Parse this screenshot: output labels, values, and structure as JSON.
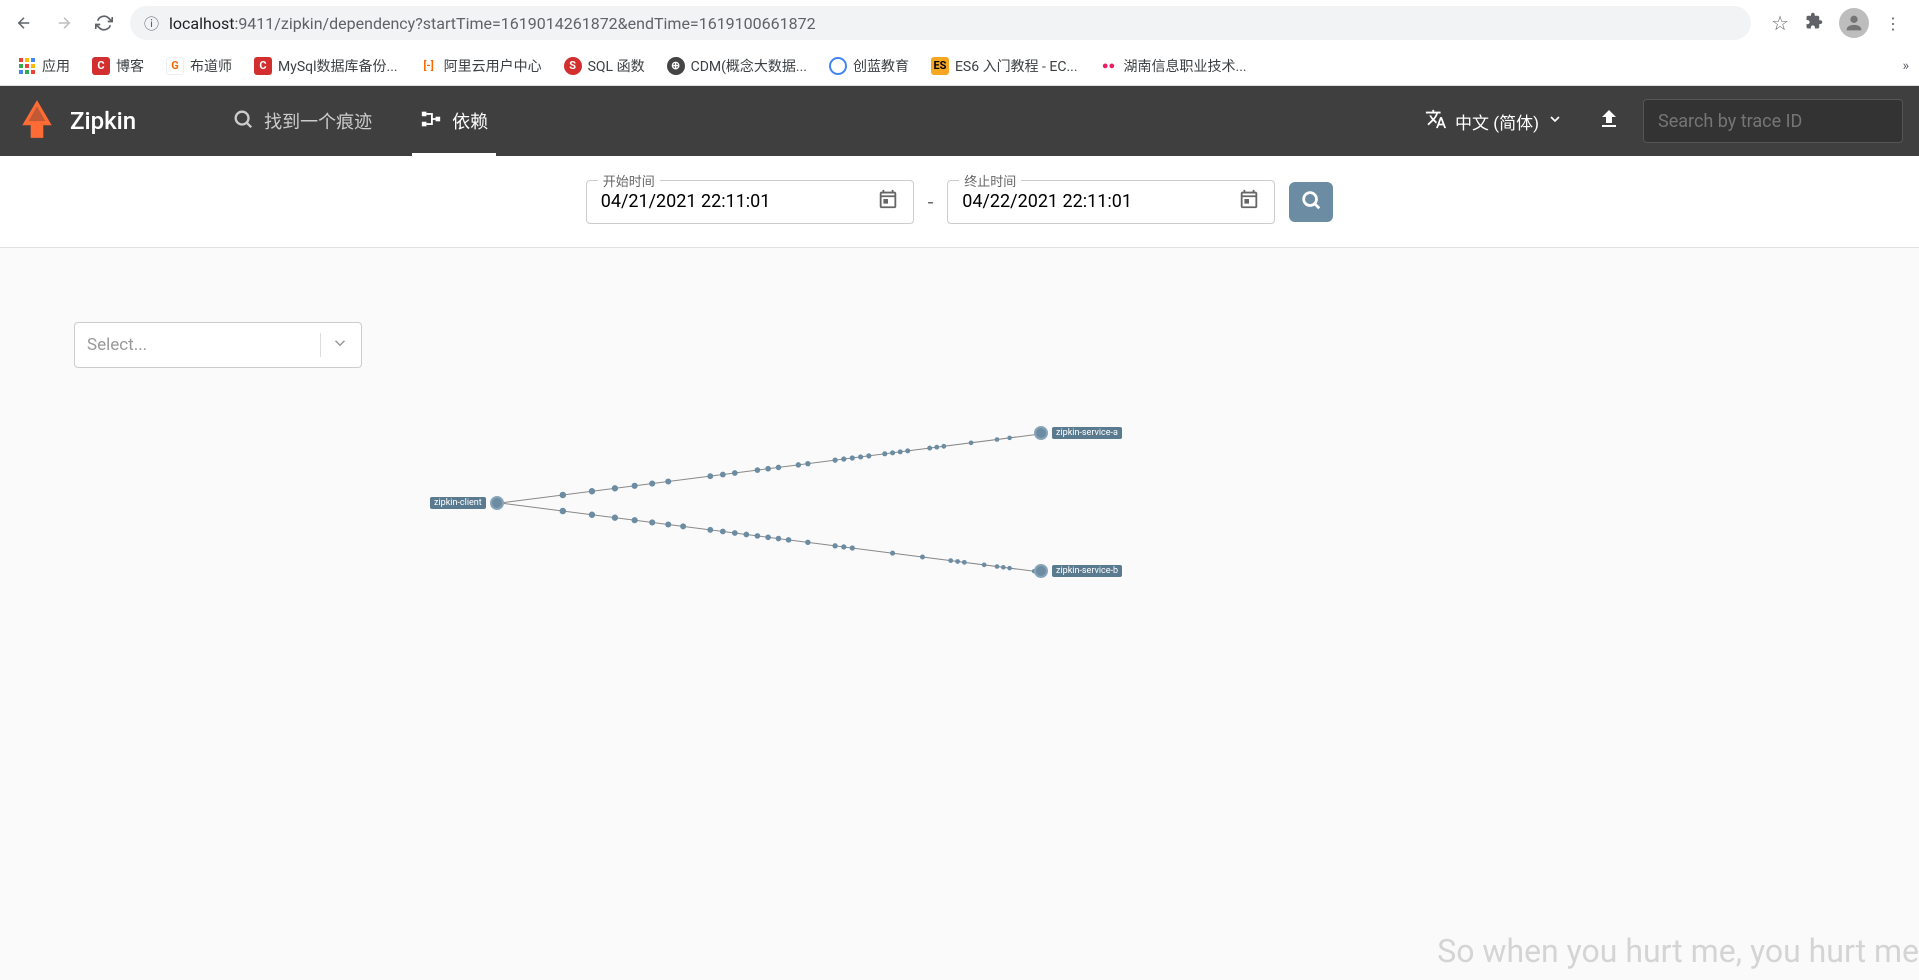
{
  "browser": {
    "url_domain": "localhost",
    "url_path": ":9411/zipkin/dependency?startTime=1619014261872&endTime=1619100661872"
  },
  "bookmarks": {
    "apps": "应用",
    "items": [
      {
        "label": "博客"
      },
      {
        "label": "布道师"
      },
      {
        "label": "MySql数据库备份..."
      },
      {
        "label": "阿里云用户中心"
      },
      {
        "label": "SQL 函数"
      },
      {
        "label": "CDM(概念大数据..."
      },
      {
        "label": "创蓝教育"
      },
      {
        "label": "ES6 入门教程 - EC..."
      },
      {
        "label": "湖南信息职业技术..."
      }
    ]
  },
  "zipkin": {
    "title": "Zipkin",
    "tabs": {
      "find": "找到一个痕迹",
      "deps": "依赖"
    },
    "language": "中文 (简体)",
    "search_placeholder": "Search by trace ID"
  },
  "filters": {
    "start_label": "开始时间",
    "start_value": "04/21/2021 22:11:01",
    "end_label": "终止时间",
    "end_value": "04/22/2021 22:11:01"
  },
  "select": {
    "placeholder": "Select..."
  },
  "graph": {
    "nodes": {
      "client": "zipkin-client",
      "service_a": "zipkin-service-a",
      "service_b": "zipkin-service-b"
    }
  },
  "watermark": "So when you hurt me, you hurt me"
}
